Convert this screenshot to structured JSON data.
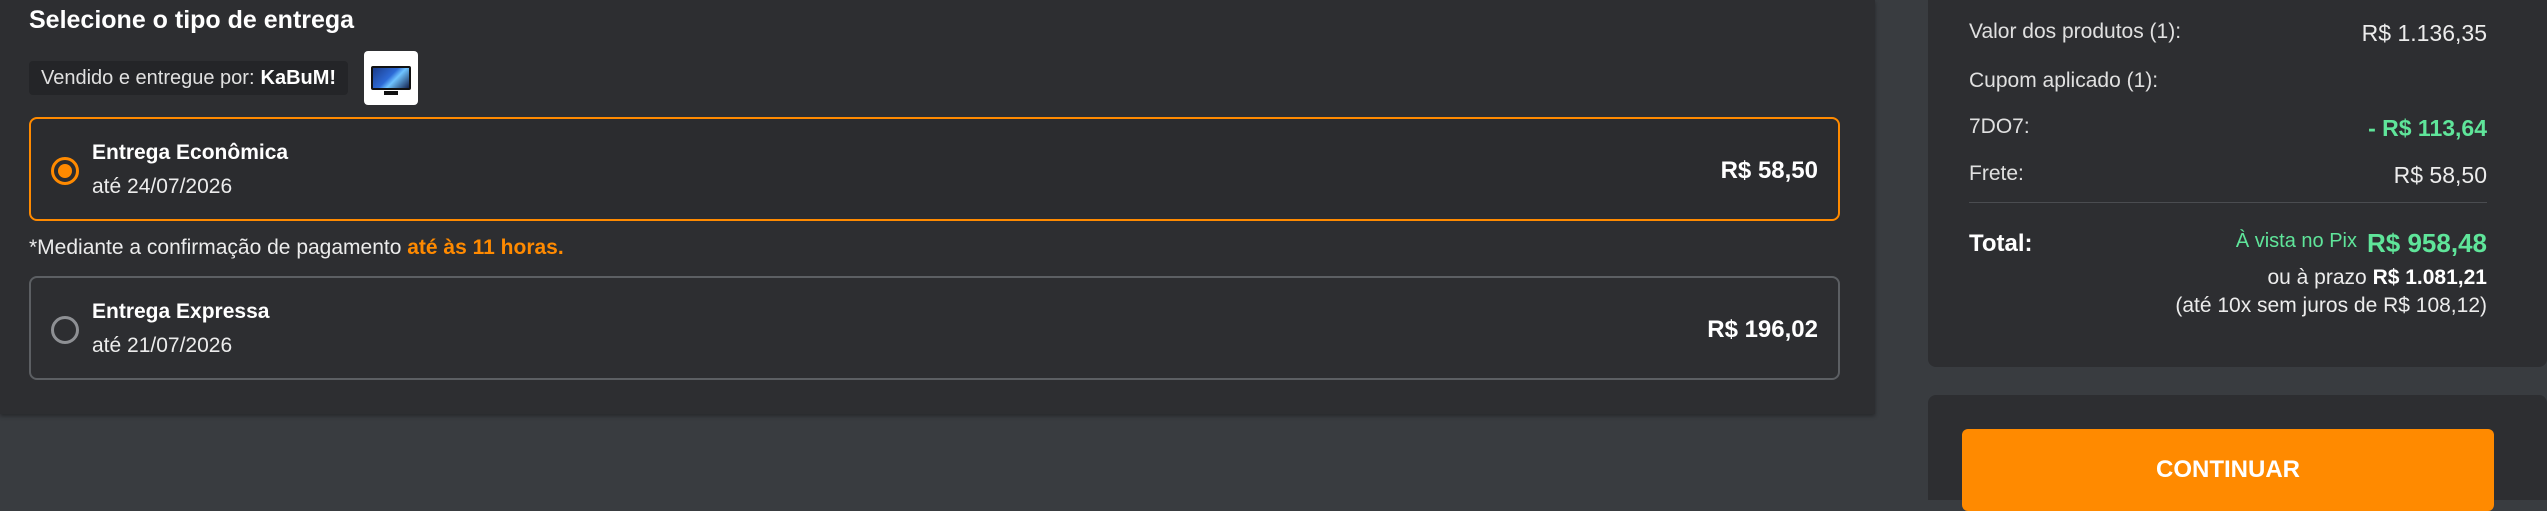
{
  "delivery": {
    "title": "Selecione o tipo de entrega",
    "seller_prefix": "Vendido e entregue por:",
    "seller_name": "KaBuM!",
    "options": [
      {
        "name": "Entrega Econômica",
        "date": "até 24/07/2026",
        "price": "R$ 58,50",
        "selected": true
      },
      {
        "name": "Entrega Expressa",
        "date": "até 21/07/2026",
        "price": "R$ 196,02",
        "selected": false
      }
    ],
    "note_prefix": "*Mediante a confirmação de pagamento",
    "note_highlight": "até às 11 horas."
  },
  "summary": {
    "products_label": "Valor dos produtos (1):",
    "products_value": "R$ 1.136,35",
    "coupon_label": "Cupom aplicado (1):",
    "coupon_code": "7DO7:",
    "coupon_value": "- R$ 113,64",
    "shipping_label": "Frete:",
    "shipping_value": "R$ 58,50",
    "total_label": "Total:",
    "pix_label": "À vista no Pix",
    "pix_value": "R$ 958,48",
    "installment_prefix": "ou à prazo",
    "installment_value": "R$ 1.081,21",
    "installment_detail": "(até 10x sem juros de R$ 108,12)"
  },
  "actions": {
    "continue_label": "CONTINUAR"
  },
  "colors": {
    "accent": "#ff8a00",
    "pix": "#5fe59a",
    "panel": "#2d2e31",
    "background": "#393c40"
  }
}
